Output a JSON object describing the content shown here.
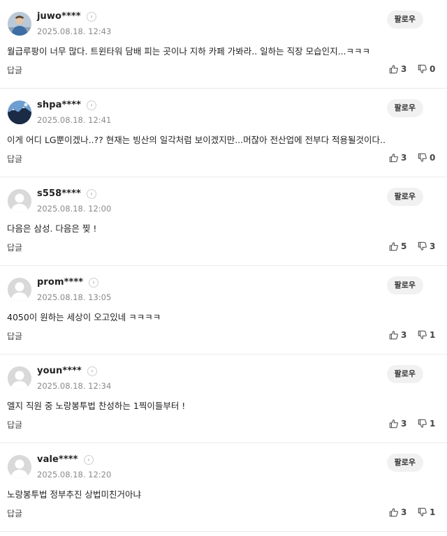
{
  "ui": {
    "follow_label": "팔로우",
    "reply_label": "답글",
    "profile_arrow": "›"
  },
  "comments": [
    {
      "username": "juwo****",
      "timestamp": "2025.08.18. 12:43",
      "text": "월급루팡이 너무 많다. 트윈타워 담배 피는 곳이나 지하 카페 가봐라.. 일하는 직장 모습인지...ㅋㅋㅋ",
      "likes": "3",
      "dislikes": "0",
      "avatar": "photo-person"
    },
    {
      "username": "shpa****",
      "timestamp": "2025.08.18. 12:41",
      "text": "이게 어디 LG뿐이겠나..?? 현재는 빙산의 일각처럼 보이겠지만...머잖아 전산업에 전부다 적용될것이다..",
      "likes": "3",
      "dislikes": "0",
      "avatar": "photo-landscape"
    },
    {
      "username": "s558****",
      "timestamp": "2025.08.18. 12:00",
      "text": "다음은 삼성. 다음은 찢 !",
      "likes": "5",
      "dislikes": "3",
      "avatar": "default"
    },
    {
      "username": "prom****",
      "timestamp": "2025.08.18. 13:05",
      "text": "4050이 원하는 세상이 오고있네 ㅋㅋㅋㅋ",
      "likes": "3",
      "dislikes": "1",
      "avatar": "default"
    },
    {
      "username": "youn****",
      "timestamp": "2025.08.18. 12:34",
      "text": "엘지 직원 중 노랑봉투법 찬성하는 1찍이들부터 !",
      "likes": "3",
      "dislikes": "1",
      "avatar": "default"
    },
    {
      "username": "vale****",
      "timestamp": "2025.08.18. 12:20",
      "text": "노랑봉투법 정부추진 상법미친거아냐",
      "likes": "3",
      "dislikes": "1",
      "avatar": "default"
    }
  ],
  "colors": {
    "follow_bg": "#f1f1f1",
    "muted_text": "#8a8a8a",
    "divider": "#ebebeb"
  }
}
